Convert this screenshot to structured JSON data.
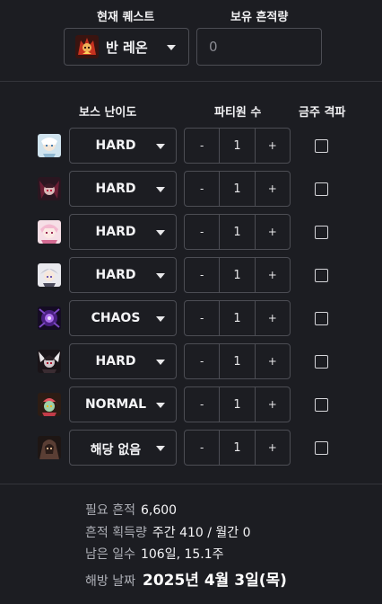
{
  "quest": {
    "label": "현재 퀘스트",
    "selected": "반 레온",
    "icon": "van-leon-boss-icon"
  },
  "owned": {
    "label": "보유 흔적량",
    "placeholder": "0"
  },
  "table": {
    "headers": {
      "difficulty": "보스 난이도",
      "party": "파티원 수",
      "cleared": "금주 격파"
    },
    "rows": [
      {
        "icon": "boss-1-icon",
        "difficulty": "HARD",
        "minus": "-",
        "party": "1",
        "plus": "+"
      },
      {
        "icon": "boss-2-icon",
        "difficulty": "HARD",
        "minus": "-",
        "party": "1",
        "plus": "+"
      },
      {
        "icon": "boss-3-icon",
        "difficulty": "HARD",
        "minus": "-",
        "party": "1",
        "plus": "+"
      },
      {
        "icon": "boss-4-icon",
        "difficulty": "HARD",
        "minus": "-",
        "party": "1",
        "plus": "+"
      },
      {
        "icon": "boss-5-icon",
        "difficulty": "CHAOS",
        "minus": "-",
        "party": "1",
        "plus": "+"
      },
      {
        "icon": "boss-6-icon",
        "difficulty": "HARD",
        "minus": "-",
        "party": "1",
        "plus": "+"
      },
      {
        "icon": "boss-7-icon",
        "difficulty": "NORMAL",
        "minus": "-",
        "party": "1",
        "plus": "+"
      },
      {
        "icon": "boss-8-icon",
        "difficulty": "해당 없음",
        "minus": "-",
        "party": "1",
        "plus": "+"
      }
    ]
  },
  "summary": {
    "required_label": "필요 흔적",
    "required_value": "6,600",
    "gain_label": "흔적 획득량",
    "gain_value": "주간 410 / 월간 0",
    "remaining_label": "남은 일수",
    "remaining_value": "106일, 15.1주",
    "release_label": "해방 날짜",
    "release_value": "2025년 4월 3일(목)"
  },
  "colors": {
    "background": "#1c1d22",
    "border": "#4c4d54",
    "text": "#e8e8ea"
  }
}
